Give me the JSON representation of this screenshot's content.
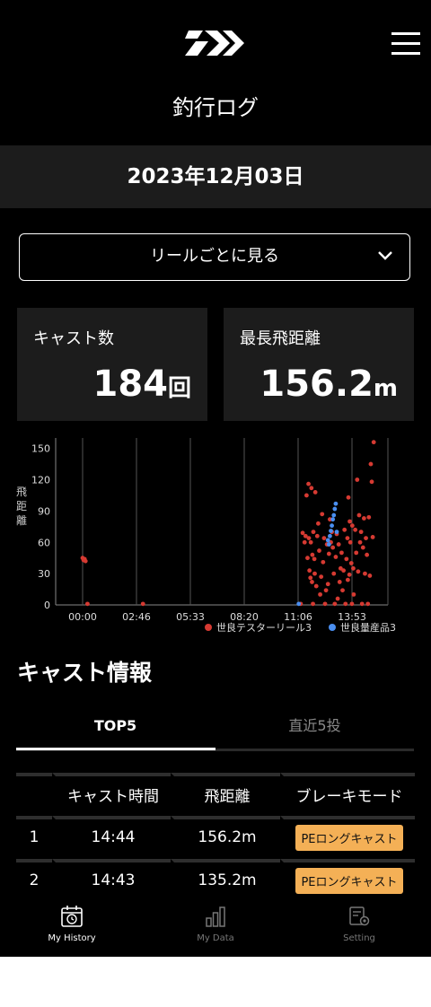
{
  "header": {
    "title": "釣行ログ"
  },
  "date": "2023年12月03日",
  "reel_select": {
    "value": "リールごとに見る"
  },
  "stats": {
    "cast_count": {
      "label": "キャスト数",
      "value": "184",
      "unit": "回"
    },
    "max_distance": {
      "label": "最長飛距離",
      "value": "156.2",
      "unit": "m"
    }
  },
  "chart_data": {
    "type": "scatter",
    "ylabel": "飛距離",
    "yticks": [
      0,
      30,
      60,
      90,
      120,
      150
    ],
    "ylim": [
      0,
      160
    ],
    "xticks": [
      "00:00",
      "02:46",
      "05:33",
      "08:20",
      "11:06",
      "13:53"
    ],
    "colors": {
      "series1": "#d63a32",
      "series2": "#4a8ef0"
    },
    "series": [
      {
        "name": "世良テスターリール3",
        "points": [
          [
            0.0,
            45
          ],
          [
            0.05,
            43
          ],
          [
            0.1,
            44
          ],
          [
            0.15,
            42
          ],
          [
            0.25,
            1
          ],
          [
            3.1,
            1
          ],
          [
            11.2,
            1
          ],
          [
            11.3,
            69
          ],
          [
            11.4,
            60
          ],
          [
            11.45,
            66
          ],
          [
            11.5,
            105
          ],
          [
            11.55,
            45
          ],
          [
            11.6,
            116
          ],
          [
            11.62,
            64
          ],
          [
            11.65,
            33
          ],
          [
            11.7,
            26
          ],
          [
            11.72,
            60
          ],
          [
            11.75,
            112
          ],
          [
            11.78,
            22
          ],
          [
            11.8,
            48
          ],
          [
            11.83,
            1
          ],
          [
            11.85,
            70
          ],
          [
            11.9,
            44
          ],
          [
            11.92,
            30
          ],
          [
            11.95,
            108
          ],
          [
            12.0,
            18
          ],
          [
            12.05,
            66
          ],
          [
            12.1,
            78
          ],
          [
            12.15,
            52
          ],
          [
            12.2,
            10
          ],
          [
            12.25,
            27
          ],
          [
            12.3,
            87
          ],
          [
            12.35,
            41
          ],
          [
            12.4,
            64
          ],
          [
            12.45,
            1
          ],
          [
            12.5,
            14
          ],
          [
            12.55,
            58
          ],
          [
            12.6,
            20
          ],
          [
            12.65,
            49
          ],
          [
            12.7,
            82
          ],
          [
            12.75,
            60
          ],
          [
            12.8,
            70
          ],
          [
            12.85,
            55
          ],
          [
            12.9,
            30
          ],
          [
            12.95,
            1
          ],
          [
            13.0,
            46
          ],
          [
            13.05,
            68
          ],
          [
            13.1,
            6
          ],
          [
            13.15,
            58
          ],
          [
            13.2,
            22
          ],
          [
            13.25,
            35
          ],
          [
            13.3,
            50
          ],
          [
            13.35,
            14
          ],
          [
            13.4,
            33
          ],
          [
            13.45,
            72
          ],
          [
            13.5,
            1
          ],
          [
            13.55,
            44
          ],
          [
            13.6,
            64
          ],
          [
            13.62,
            24
          ],
          [
            13.65,
            103
          ],
          [
            13.7,
            29
          ],
          [
            13.72,
            80
          ],
          [
            13.75,
            60
          ],
          [
            13.8,
            40
          ],
          [
            13.83,
            1
          ],
          [
            13.85,
            76
          ],
          [
            13.9,
            35
          ],
          [
            13.92,
            10
          ],
          [
            14.0,
            72
          ],
          [
            14.05,
            50
          ],
          [
            14.1,
            120
          ],
          [
            14.15,
            32
          ],
          [
            14.2,
            86
          ],
          [
            14.25,
            60
          ],
          [
            14.3,
            70
          ],
          [
            14.35,
            1
          ],
          [
            14.4,
            55
          ],
          [
            14.45,
            83
          ],
          [
            14.5,
            30
          ],
          [
            14.55,
            64
          ],
          [
            14.6,
            48
          ],
          [
            14.65,
            1
          ],
          [
            14.7,
            84
          ],
          [
            14.75,
            28
          ],
          [
            14.8,
            135
          ],
          [
            14.85,
            118
          ],
          [
            14.9,
            65
          ],
          [
            14.95,
            156
          ]
        ]
      },
      {
        "name": "世良量産品3",
        "points": [
          [
            11.1,
            1
          ],
          [
            12.6,
            62
          ],
          [
            12.7,
            66
          ],
          [
            12.75,
            71
          ],
          [
            12.8,
            76
          ],
          [
            12.85,
            82
          ],
          [
            12.9,
            86
          ],
          [
            12.95,
            92
          ],
          [
            13.0,
            97
          ],
          [
            13.05,
            70
          ],
          [
            12.65,
            58
          ]
        ]
      }
    ]
  },
  "cast_info": {
    "title": "キャスト情報",
    "tabs": [
      {
        "label": "TOP5"
      },
      {
        "label": "直近5投"
      }
    ],
    "columns": [
      "キャスト時間",
      "飛距離",
      "ブレーキモード"
    ],
    "rows": [
      {
        "rank": "1",
        "time": "14:44",
        "distance": "156.2m",
        "mode": "PEロングキャスト"
      },
      {
        "rank": "2",
        "time": "14:43",
        "distance": "135.2m",
        "mode": "PEロングキャスト"
      }
    ]
  },
  "bottom_nav": [
    {
      "label": "My History",
      "active": true
    },
    {
      "label": "My Data",
      "active": false
    },
    {
      "label": "Setting",
      "active": false
    }
  ]
}
